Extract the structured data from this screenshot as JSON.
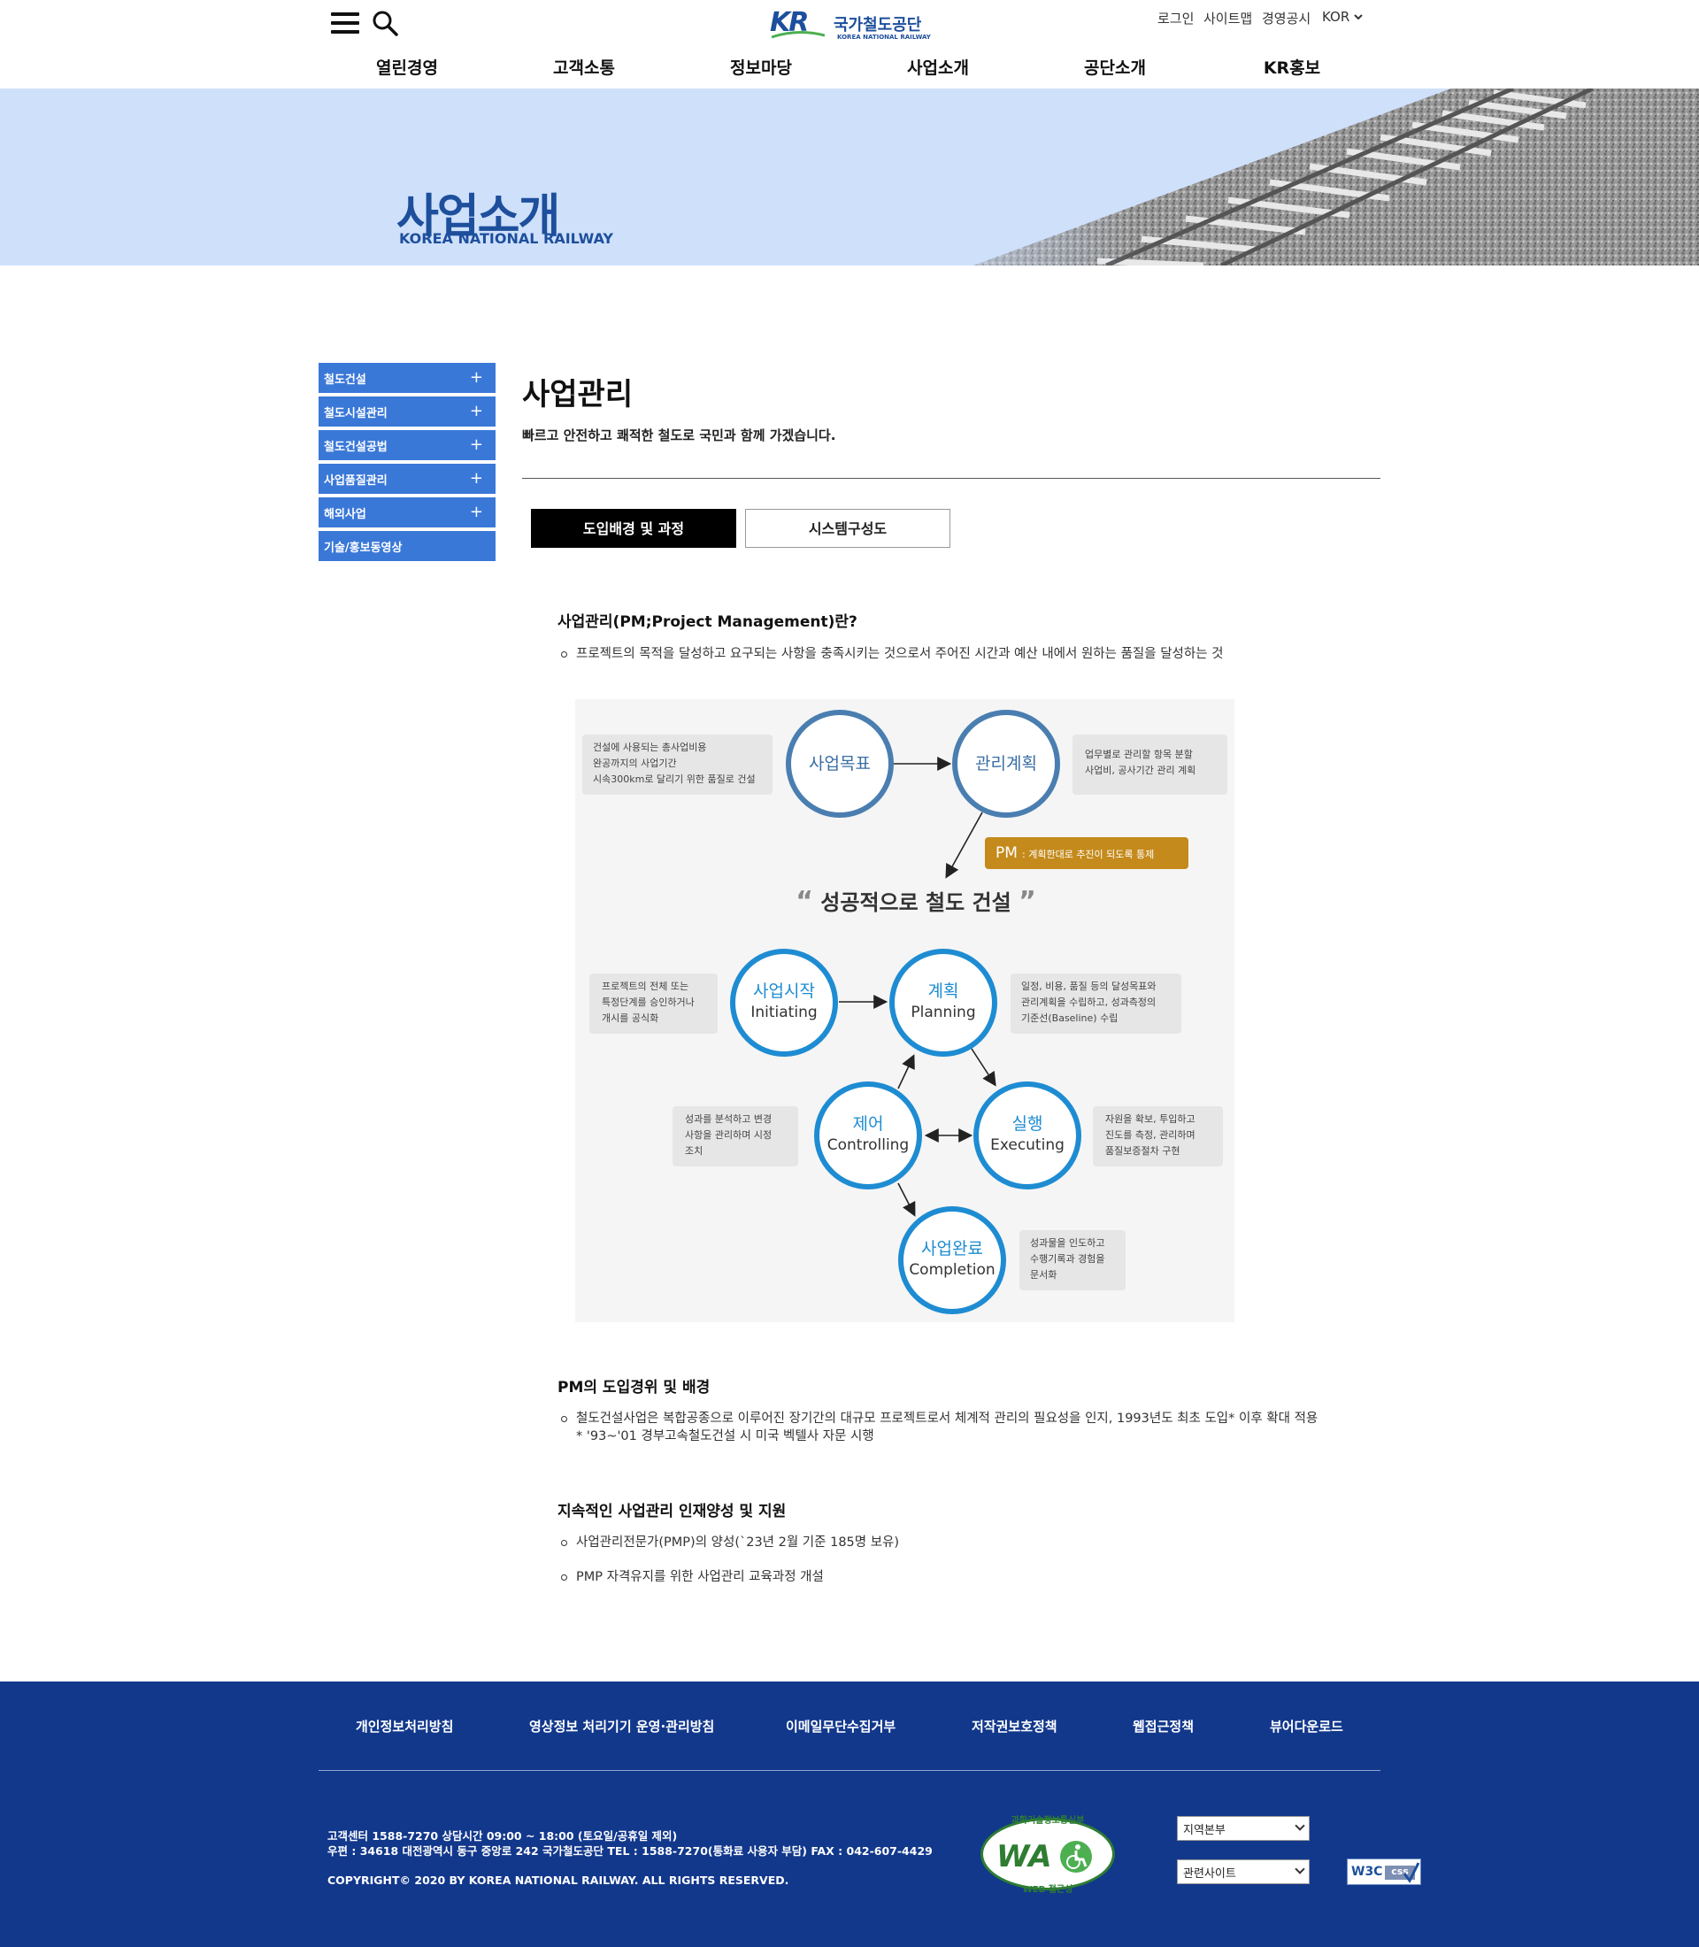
{
  "header": {
    "logo": {
      "mark": "KR",
      "name": "국가철도공단",
      "sub": "KOREA NATIONAL RAILWAY"
    },
    "util": {
      "login": "로그인",
      "sitemap": "사이트맵",
      "disclosure": "경영공시",
      "lang": "KOR"
    },
    "gnb": [
      "열린경영",
      "고객소통",
      "정보마당",
      "사업소개",
      "공단소개",
      "KR홍보"
    ]
  },
  "banner": {
    "title": "사업소개",
    "subtitle": "KOREA NATIONAL RAILWAY"
  },
  "sidebar": {
    "items": [
      {
        "label": "철도건설",
        "plus": "+"
      },
      {
        "label": "철도시설관리",
        "plus": "+"
      },
      {
        "label": "철도건설공법",
        "plus": "+"
      },
      {
        "label": "사업품질관리",
        "plus": "+"
      },
      {
        "label": "해외사업",
        "plus": "+"
      },
      {
        "label": "기술/홍보동영상",
        "plus": ""
      }
    ]
  },
  "main": {
    "title": "사업관리",
    "desc": "빠르고 안전하고 쾌적한 철도로 국민과 함께 가겠습니다.",
    "tabs": [
      {
        "label": "도입배경 및 과정",
        "active": true
      },
      {
        "label": "시스템구성도",
        "active": false
      }
    ],
    "section1": {
      "heading": "사업관리(PM;Project Management)란?",
      "bullet": "프로젝트의 목적을 달성하고 요구되는 사항을 충족시키는 것으로서 주어진 시간과 예산 내에서 원하는 품질을 달성하는 것"
    },
    "section2": {
      "heading": "PM의 도입경위 및 배경",
      "bullet_line1": "철도건설사업은 복합공종으로 이루어진 장기간의 대규모 프로젝트로서 체계적 관리의 필요성을 인지, 1993년도 최초 도입* 이후 확대 적용",
      "bullet_line2": "* '93~'01 경부고속철도건설 시 미국 벡텔사 자문 시행"
    },
    "section3": {
      "heading": "지속적인 사업관리 인재양성 및 지원",
      "bullets": [
        "사업관리전문가(PMP)의 양성(`23년 2월 기준 185명 보유)",
        "PMP 자격유지를 위한 사업관리 교육과정 개설"
      ]
    }
  },
  "diagram": {
    "top_left_note": [
      "건설에 사용되는 총사업비용",
      "완공까지의 사업기간",
      "시속300km로 달리기 위한 품질로 건설"
    ],
    "goal": "사업목표",
    "plan_mgmt": "관리계획",
    "top_right_note": [
      "업무별로 관리할 항목 분할",
      "사업비, 공사기간 관리 계획"
    ],
    "pm_label": "PM",
    "pm_text": ": 계획한대로 추진이 되도록 통제",
    "slogan": "성공적으로 철도 건설",
    "initiating": {
      "ko": "사업시작",
      "en": "Initiating",
      "note": [
        "프로젝트의 전체 또는",
        "특정단계를 승인하거나",
        "개시를 공식화"
      ]
    },
    "planning": {
      "ko": "계획",
      "en": "Planning",
      "note": [
        "일정, 비용, 품질 등의 달성목표와",
        "관리계획을 수립하고, 성과측정의",
        "기준선(Baseline) 수립"
      ]
    },
    "controlling": {
      "ko": "제어",
      "en": "Controlling",
      "note": [
        "성과를 분석하고 변경",
        "사항을 관리하며 시정",
        "조치"
      ]
    },
    "executing": {
      "ko": "실행",
      "en": "Executing",
      "note": [
        "자원을 확보, 투입하고",
        "진도를 측정, 관리하며",
        "품질보증절차 구현"
      ]
    },
    "completion": {
      "ko": "사업완료",
      "en": "Completion",
      "note": [
        "성과물을 인도하고",
        "수행기록과 경험을",
        "문서화"
      ]
    }
  },
  "footer": {
    "links": [
      "개인정보처리방침",
      "영상정보 처리기기 운영·관리방침",
      "이메일무단수집거부",
      "저작권보호정책",
      "웹접근정책",
      "뷰어다운로드"
    ],
    "info1": "고객센터 1588-7270 상담시간 09:00 ~ 18:00 (토요일/공휴일 제외)",
    "info2": "우편 : 34618 대전광역시 동구 중앙로 242 국가철도공단 TEL : 1588-7270(통화료 사용자 부담) FAX : 042-607-4429",
    "copyright": "COPYRIGHT© 2020 BY KOREA NATIONAL RAILWAY. ALL RIGHTS RESERVED.",
    "wa_top": "과학기술정보통신부",
    "wa_mark": "WA",
    "wa_bottom": "WEB 접근성",
    "select_region": "지역본부",
    "select_related": "관련사이트",
    "w3c": "W3C",
    "w3c_css": "css"
  }
}
